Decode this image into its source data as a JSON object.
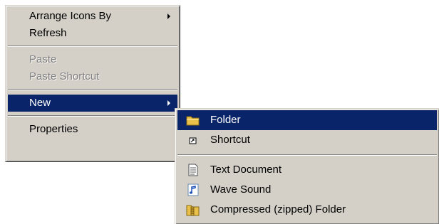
{
  "context_menu": {
    "items": [
      {
        "label": "Arrange Icons By",
        "has_submenu": true
      },
      {
        "label": "Refresh"
      },
      {
        "label": "Paste",
        "disabled": true
      },
      {
        "label": "Paste Shortcut",
        "disabled": true
      },
      {
        "label": "New",
        "has_submenu": true,
        "highlighted": true
      },
      {
        "label": "Properties"
      }
    ]
  },
  "new_submenu": {
    "items": [
      {
        "label": "Folder",
        "icon": "folder-icon",
        "highlighted": true
      },
      {
        "label": "Shortcut",
        "icon": "shortcut-icon"
      },
      {
        "label": "Text Document",
        "icon": "text-document-icon"
      },
      {
        "label": "Wave Sound",
        "icon": "wave-sound-icon"
      },
      {
        "label": "Compressed (zipped) Folder",
        "icon": "zipped-folder-icon"
      }
    ]
  },
  "colors": {
    "menu_background": "#d4d0c8",
    "highlight_background": "#0a246a",
    "highlight_text": "#ffffff",
    "disabled_text": "#808080"
  }
}
